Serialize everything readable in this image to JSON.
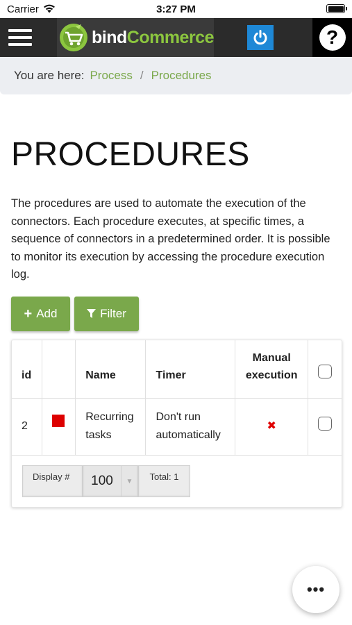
{
  "status_bar": {
    "carrier": "Carrier",
    "time": "3:27 PM"
  },
  "header": {
    "logo_prefix": "bind",
    "logo_suffix": "Commerce",
    "help_label": "?"
  },
  "breadcrumb": {
    "label": "You are here:",
    "items": [
      "Process",
      "Procedures"
    ],
    "separator": "/"
  },
  "page": {
    "title": "PROCEDURES",
    "description": "The procedures are used to automate the execution of the connectors. Each procedure executes, at specific times, a sequence of connectors in a predetermined order. It is possible to monitor its execution by accessing the procedure execution log."
  },
  "toolbar": {
    "add_label": "Add",
    "filter_label": "Filter"
  },
  "table": {
    "headers": {
      "id": "id",
      "name": "Name",
      "timer": "Timer",
      "manual": "Manual execution"
    },
    "rows": [
      {
        "id": "2",
        "color": "#dd0000",
        "name": "Recurring tasks",
        "timer": "Don't run automatically",
        "manual_symbol": "✖"
      }
    ]
  },
  "pager": {
    "display_label": "Display #",
    "page_size": "100",
    "total_label": "Total: 1"
  },
  "fab": {
    "label": "•••"
  },
  "colors": {
    "accent": "#7aa84b",
    "header_bg": "#2b2b2b",
    "power_blue": "#1e88d6",
    "error_red": "#e00000"
  }
}
